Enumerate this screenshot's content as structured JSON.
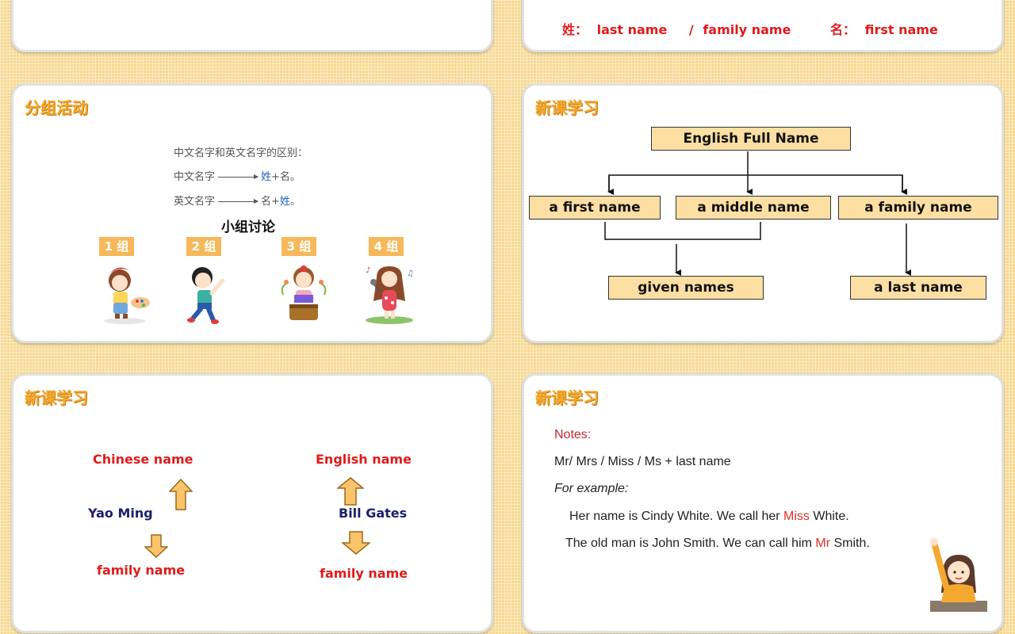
{
  "slide_top_right": {
    "xing_label": "姓：",
    "last_name": "last name",
    "slash": "/",
    "family_name": "family name",
    "ming_label": "名：",
    "first_name": "first name"
  },
  "slide_group": {
    "title": "分组活动",
    "line1": "中文名字和英文名字的区别：",
    "line2_prefix": "中文名字",
    "line2_a": "姓",
    "line2_b": "+名。",
    "line3_prefix": "英文名字",
    "line3_a": "名+",
    "line3_b": "姓",
    "line3_c": "。",
    "discussion": "小组讨论",
    "groups": [
      "1 组",
      "2 组",
      "3 组",
      "4 组"
    ]
  },
  "slide_diagram": {
    "title": "新课学习",
    "root": "English Full Name",
    "first": "a first name",
    "middle": "a middle name",
    "family": "a family name",
    "given": "given names",
    "last": "a last name"
  },
  "slide_names": {
    "title": "新课学习",
    "cn_top": "Chinese name",
    "cn_person": "Yao Ming",
    "cn_bottom": "family name",
    "en_top": "English name",
    "en_person": "Bill Gates",
    "en_bottom": "family name"
  },
  "slide_notes": {
    "title": "新课学习",
    "notes": "Notes:",
    "rule": "Mr/ Mrs / Miss / Ms + last name",
    "example": "For example:",
    "ex1_a": "Her name is Cindy White. We call her ",
    "ex1_b": "Miss",
    "ex1_c": " White.",
    "ex2_a": "The old man is John Smith. We can call him ",
    "ex2_b": "Mr",
    "ex2_c": " Smith."
  },
  "colors": {
    "accent": "#f3a82c",
    "red": "#e01b1b",
    "navy": "#1b1f6b",
    "box": "#fddfa3"
  }
}
